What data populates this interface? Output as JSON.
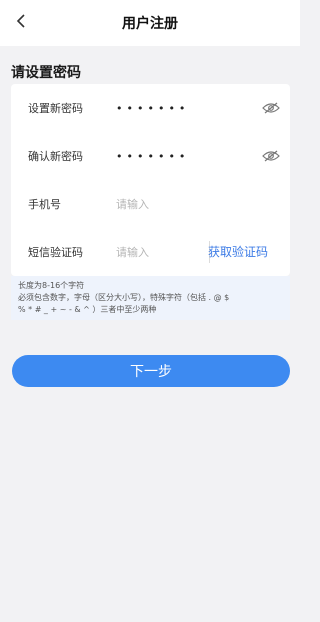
{
  "header": {
    "title": "用户注册",
    "back_icon": "chevron-left-icon"
  },
  "form": {
    "section_title": "请设置密码",
    "fields": [
      {
        "label": "设置新密码",
        "value": "•••••••",
        "icon": "eye-off-icon"
      },
      {
        "label": "确认新密码",
        "value": "•••••••",
        "icon": "eye-off-icon"
      },
      {
        "label": "手机号",
        "placeholder": "请输入"
      },
      {
        "label": "短信验证码",
        "placeholder": "请输入",
        "action": "获取验证码"
      }
    ]
  },
  "hint": {
    "line1": "长度为8-16个字符",
    "line2": "必须包含数字，字母（区分大小写），特殊字符（包括 . @ $",
    "line3": "% * # _ + ~ - & ^ ）三者中至少两种"
  },
  "actions": {
    "next_label": "下一步"
  },
  "colors": {
    "accent": "#3d8af1",
    "link": "#3c7be6",
    "hint_bg": "#eef3fc",
    "page_bg": "#f2f2f4"
  }
}
